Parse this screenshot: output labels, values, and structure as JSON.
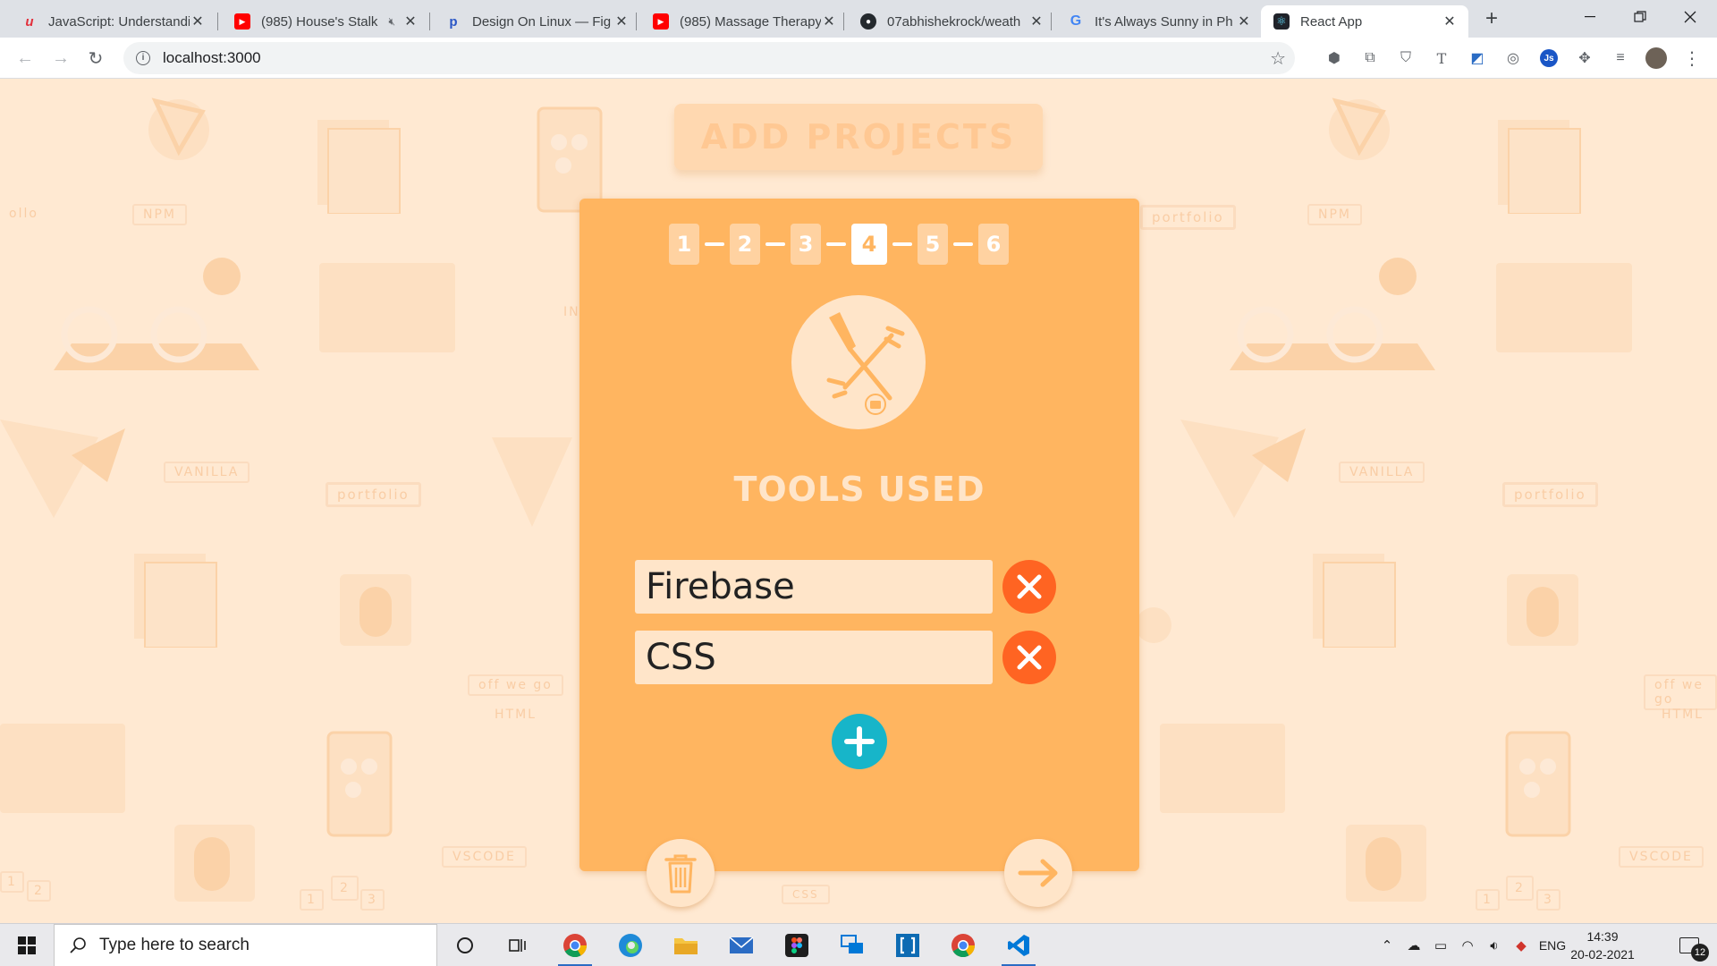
{
  "browser": {
    "tabs": [
      {
        "title": "JavaScript: Understandi",
        "favicon": "udemy-icon"
      },
      {
        "title": "(985) House's Stalk",
        "favicon": "youtube-icon",
        "muted": true
      },
      {
        "title": "Design On Linux — Fig",
        "favicon": "page-icon"
      },
      {
        "title": "(985) Massage Therapy",
        "favicon": "youtube-icon"
      },
      {
        "title": "07abhishekrock/weath",
        "favicon": "github-icon"
      },
      {
        "title": "It's Always Sunny in Ph",
        "favicon": "google-icon"
      },
      {
        "title": "React App",
        "favicon": "react-icon",
        "active": true
      }
    ],
    "url": "localhost:3000"
  },
  "page": {
    "heading": "ADD PROJECTS",
    "steps": [
      "1",
      "2",
      "3",
      "4",
      "5",
      "6"
    ],
    "active_step": "4",
    "section_title": "TOOLS USED",
    "tools": [
      "Firebase",
      "CSS"
    ],
    "background_labels": [
      "NPM",
      "NPM",
      "VANILLA",
      "VANILLA",
      "portfolio",
      "portfolio",
      "portfolio",
      "off we go",
      "HTML",
      "off we go",
      "HTML",
      "VSCODE",
      "VSCODE",
      "CSS",
      "IN",
      "1",
      "2",
      "3",
      "1",
      "2",
      "3",
      "1",
      "2",
      "ollo"
    ]
  },
  "taskbar": {
    "search_placeholder": "Type here to search",
    "language": "ENG",
    "time": "14:39",
    "date": "20-02-2021",
    "notification_count": "12"
  },
  "colors": {
    "page_bg": "#ffe9d2",
    "card": "#ffb560",
    "accent_remove": "#ff6422",
    "accent_add": "#17b5c9",
    "light": "#ffe5c9"
  }
}
